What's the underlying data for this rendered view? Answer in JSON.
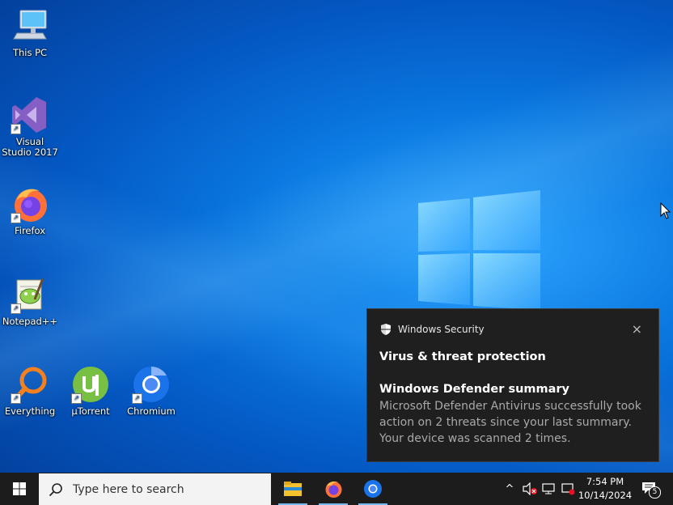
{
  "desktop": {
    "icons": [
      {
        "label": "This PC",
        "icon": "this-pc-icon"
      },
      {
        "label": "Visual Studio 2017",
        "icon": "visual-studio-icon"
      },
      {
        "label": "Firefox",
        "icon": "firefox-icon"
      },
      {
        "label": "Notepad++",
        "icon": "notepadpp-icon"
      },
      {
        "label": "Everything",
        "icon": "everything-icon"
      },
      {
        "label": "µTorrent",
        "icon": "utorrent-icon"
      },
      {
        "label": "Chromium",
        "icon": "chromium-icon"
      }
    ]
  },
  "notification": {
    "app_name": "Windows Security",
    "title": "Virus & threat protection",
    "subtitle": "Windows Defender summary",
    "body": "Microsoft Defender Antivirus successfully took action on 2 threats since your last summary.  Your device was scanned 2 times.",
    "close_icon": "×"
  },
  "taskbar": {
    "search_placeholder": "Type here to search",
    "pinned": [
      "file-explorer-icon",
      "firefox-icon",
      "chromium-icon"
    ],
    "tray": {
      "chevron": "^",
      "time": "7:54 PM",
      "date": "10/14/2024",
      "notification_count": "5"
    }
  },
  "colors": {
    "taskbar_bg": "#1c1c1c",
    "toast_bg": "#1f1f1f",
    "desktop_blue": "#0a78e0"
  }
}
